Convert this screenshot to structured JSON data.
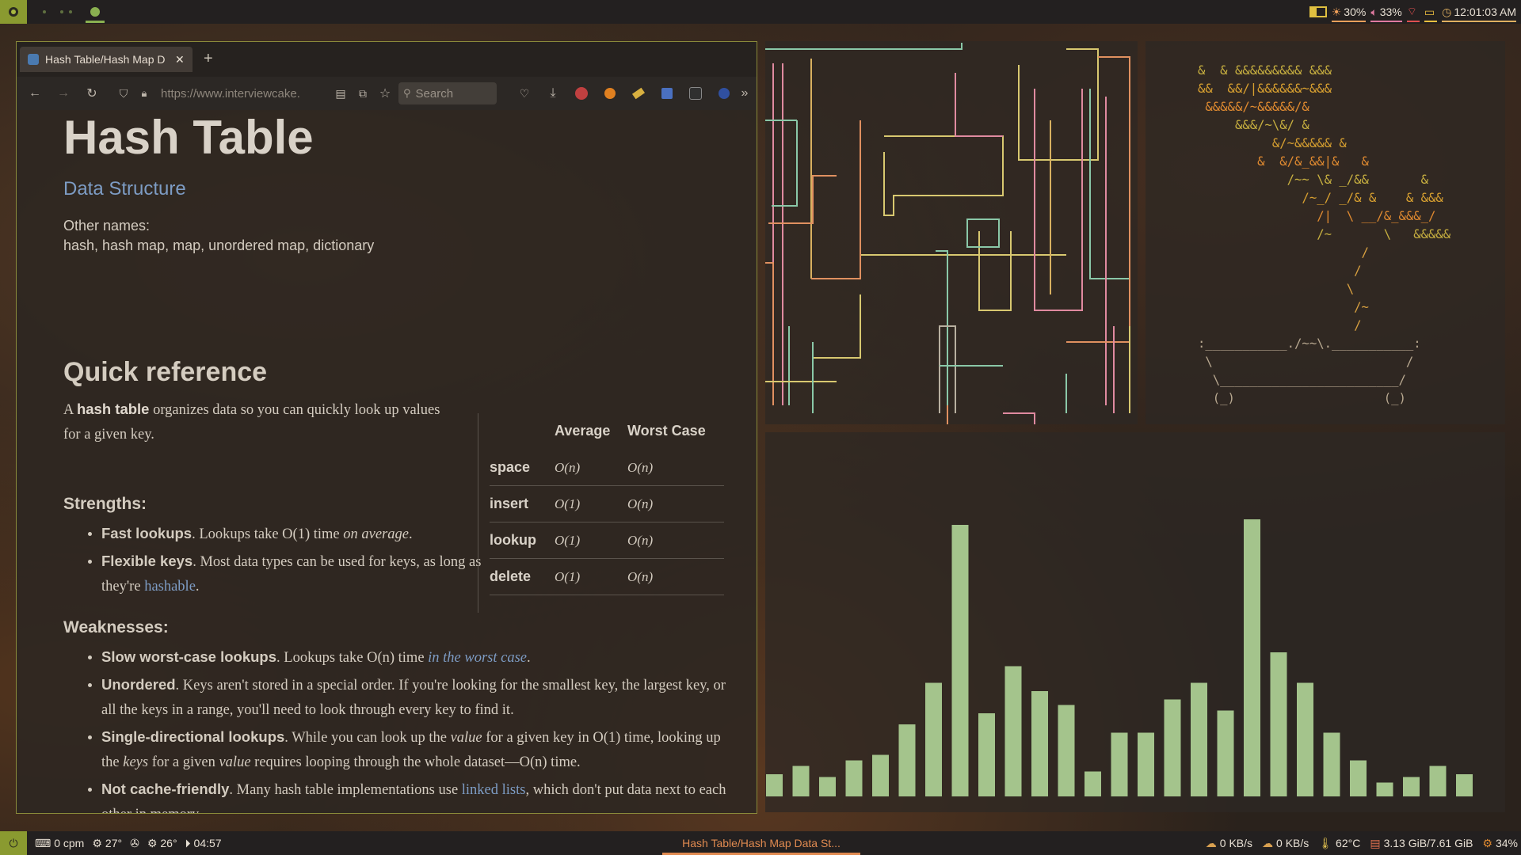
{
  "topbar": {
    "status": [
      {
        "icon": "brightness-icon",
        "text": "30%",
        "color": "#f0a05a"
      },
      {
        "icon": "volume-icon",
        "text": "33%",
        "color": "#e07aa0"
      },
      {
        "icon": "wifi-icon",
        "text": "",
        "color": "#e05050"
      },
      {
        "icon": "battery-icon",
        "text": "",
        "color": "#f0c040"
      },
      {
        "icon": "clock-icon",
        "text": "12:01:03 AM",
        "color": "#e0b060"
      }
    ]
  },
  "browser": {
    "tab_title": "Hash Table/Hash Map D",
    "new_tab": "+",
    "url": "https://www.interviewcake.",
    "search_placeholder": "Search"
  },
  "article": {
    "title": "Hash Table",
    "subtitle": "Data Structure",
    "other_names_label": "Other names:",
    "other_names": "hash, hash map, map, unordered map, dictionary",
    "quick_ref": "Quick reference",
    "intro_1": "A",
    "intro_bold": "hash table",
    "intro_2": "organizes data so you can quickly look up values for a given key.",
    "strengths": "Strengths:",
    "s1_b": "Fast lookups",
    "s1_t": ". Lookups take O(1) time",
    "s1_i": "on average",
    "s1_e": ".",
    "s2_b": "Flexible keys",
    "s2_t": ". Most data types can be used for keys, as long as they're",
    "s2_l": "hashable",
    "s2_e": ".",
    "weaknesses": "Weaknesses:",
    "w1_b": "Slow worst-case lookups",
    "w1_t": ". Lookups take O(n) time",
    "w1_l": "in the worst case",
    "w1_e": ".",
    "w2_b": "Unordered",
    "w2_t": ". Keys aren't stored in a special order. If you're looking for the smallest key, the largest key, or all the keys in a range, you'll need to look through every key to find it.",
    "w3_b": "Single-directional lookups",
    "w3_t1": ". While you can look up the",
    "w3_i1": "value",
    "w3_t2": "for a given key in O(1) time, looking up the",
    "w3_i2": "keys",
    "w3_t3": "for a given",
    "w3_i3": "value",
    "w3_t4": "requires looping through the whole dataset—O(n) time.",
    "w4_b": "Not cache-friendly",
    "w4_t": ". Many hash table implementations use",
    "w4_l": "linked lists",
    "w4_e": ", which don't put data next to each other in memory.",
    "table": {
      "headers": [
        "",
        "Average",
        "Worst Case"
      ],
      "rows": [
        [
          "space",
          "O(n)",
          "O(n)"
        ],
        [
          "insert",
          "O(1)",
          "O(n)"
        ],
        [
          "lookup",
          "O(1)",
          "O(n)"
        ],
        [
          "delete",
          "O(1)",
          "O(n)"
        ]
      ]
    }
  },
  "ascii_art": "&  & &&&&&&&&& &&&\n&&  &&/|&&&&&&~&&&\n &&&&&/~&&&&&/&\n     &&&/~\\&/ &\n          &/~&&&&& &\n        &  &/&_&&|&   &\n            /~~ \\& _/&&       &\n              /~_/ _/& &    & &&&\n                /|  \\ __/&_&&&_/\n                /~       \\   &&&&&\n                      /\n                     /\n                    \\\n                     /~\n                     /\n:___________./~~\\.___________:\n \\                          /\n  \\________________________/\n  (_)                    (_)",
  "ascii_colors": [
    "#c8b040",
    "#d8a030",
    "#e08a30"
  ],
  "bar_chart": {
    "values": [
      0.08,
      0.11,
      0.07,
      0.13,
      0.15,
      0.26,
      0.41,
      0.98,
      0.3,
      0.47,
      0.38,
      0.33,
      0.09,
      0.23,
      0.23,
      0.35,
      0.41,
      0.31,
      1.0,
      0.52,
      0.41,
      0.23,
      0.13,
      0.05,
      0.07,
      0.11,
      0.08
    ],
    "color": "#a4c48c"
  },
  "bottombar": {
    "left": [
      {
        "icon": "power-icon",
        "text": ""
      },
      {
        "icon": "keyboard-icon",
        "text": "0 cpm"
      },
      {
        "icon": "cpu-temp-icon",
        "text": "27°"
      },
      {
        "icon": "fan-icon",
        "text": ""
      },
      {
        "icon": "gpu-temp-icon",
        "text": "26°"
      },
      {
        "icon": "uptime-icon",
        "text": "04:57"
      }
    ],
    "window_title": "Hash Table/Hash Map Data St...",
    "right": [
      {
        "icon": "download-icon",
        "text": "0 KB/s"
      },
      {
        "icon": "upload-icon",
        "text": "0 KB/s"
      },
      {
        "icon": "thermometer-icon",
        "text": "62°C"
      },
      {
        "icon": "memory-icon",
        "text": "3.13 GiB/7.61 GiB"
      },
      {
        "icon": "cpu-icon",
        "text": "34%"
      }
    ]
  }
}
